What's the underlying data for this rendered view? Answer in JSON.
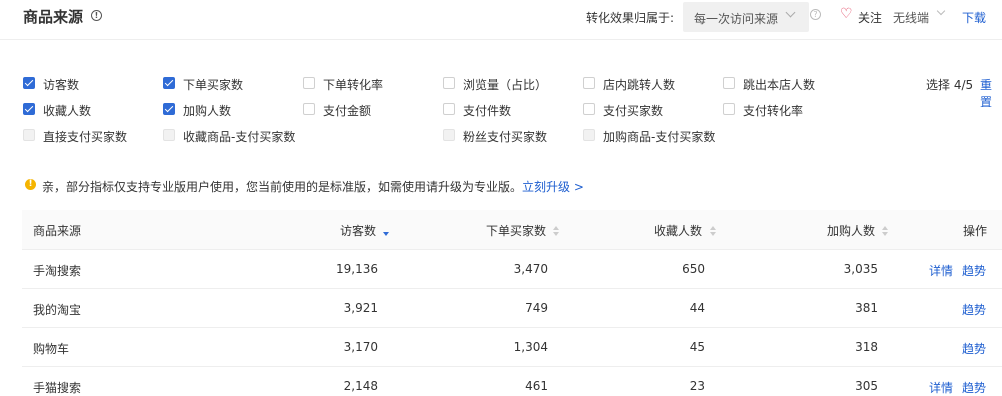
{
  "header": {
    "title": "商品来源",
    "attribution_label": "转化效果归属于:",
    "attribution_value": "每一次访问来源",
    "follow_label": "关注",
    "wireless_label": "无线端",
    "download_label": "下载"
  },
  "metrics": {
    "options": [
      {
        "label": "访客数",
        "state": "checked"
      },
      {
        "label": "下单买家数",
        "state": "checked"
      },
      {
        "label": "下单转化率",
        "state": "unchecked"
      },
      {
        "label": "浏览量（占比）",
        "state": "unchecked"
      },
      {
        "label": "店内跳转人数",
        "state": "unchecked"
      },
      {
        "label": "跳出本店人数",
        "state": "unchecked"
      },
      {
        "label": "收藏人数",
        "state": "checked"
      },
      {
        "label": "加购人数",
        "state": "checked"
      },
      {
        "label": "支付金额",
        "state": "unchecked"
      },
      {
        "label": "支付件数",
        "state": "unchecked"
      },
      {
        "label": "支付买家数",
        "state": "unchecked"
      },
      {
        "label": "支付转化率",
        "state": "unchecked"
      },
      {
        "label": "直接支付买家数",
        "state": "disabled"
      },
      {
        "label": "收藏商品-支付买家数",
        "state": "disabled"
      },
      {
        "label": "粉丝支付买家数",
        "state": "disabled"
      },
      {
        "label": "加购商品-支付买家数",
        "state": "disabled"
      }
    ],
    "selection_count": "选择 4/5",
    "reset_label": "重置"
  },
  "notice": {
    "icon": "!",
    "text": "亲，部分指标仅支持专业版用户使用，您当前使用的是标准版，如需使用请升级为专业版。",
    "link": "立刻升级 >"
  },
  "table": {
    "columns": [
      "商品来源",
      "访客数",
      "下单买家数",
      "收藏人数",
      "加购人数",
      "操作"
    ],
    "rows": [
      {
        "source": "手淘搜索",
        "visitors": "19,136",
        "buyers": "3,470",
        "favorites": "650",
        "cart_adds": "3,035",
        "details": "详情",
        "trend": "趋势"
      },
      {
        "source": "我的淘宝",
        "visitors": "3,921",
        "buyers": "749",
        "favorites": "44",
        "cart_adds": "381",
        "details": "",
        "trend": "趋势"
      },
      {
        "source": "购物车",
        "visitors": "3,170",
        "buyers": "1,304",
        "favorites": "45",
        "cart_adds": "318",
        "details": "",
        "trend": "趋势"
      },
      {
        "source": "手猫搜索",
        "visitors": "2,148",
        "buyers": "461",
        "favorites": "23",
        "cart_adds": "305",
        "details": "详情",
        "trend": "趋势"
      }
    ]
  },
  "colors": {
    "accent": "#2f6bd6",
    "link": "#1f5fd0",
    "heart": "#e03c5a",
    "warning": "#f5b400"
  }
}
